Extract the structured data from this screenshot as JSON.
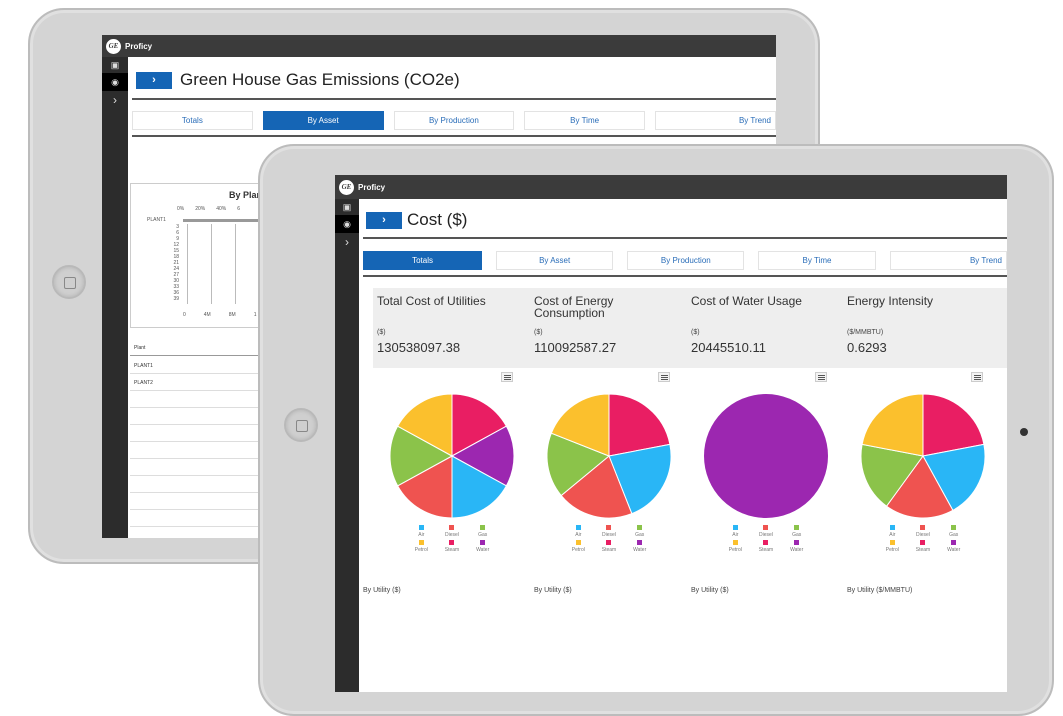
{
  "app_name": "Proficy",
  "colors": {
    "accent": "#1565b5",
    "topbar": "#3b3b3b",
    "sidebar": "#2c2c2c"
  },
  "back_tablet": {
    "page_title": "Green House Gas Emissions (CO2e)",
    "tabs": [
      {
        "label": "Totals",
        "active": false
      },
      {
        "label": "By Asset",
        "active": true
      },
      {
        "label": "By Production",
        "active": false
      },
      {
        "label": "By Time",
        "active": false
      },
      {
        "label": "By Trend",
        "active": false
      }
    ],
    "chart_title_partial": "By Plan",
    "top_axis_ticks": [
      "0%",
      "20%",
      "40%",
      "6"
    ],
    "row_label": "PLANT1",
    "y_ticks": [
      "3",
      "6",
      "9",
      "12",
      "15",
      "18",
      "21",
      "24",
      "27",
      "30",
      "33",
      "36",
      "39"
    ],
    "bottom_axis_ticks": [
      "0",
      "4M",
      "8M",
      "1"
    ],
    "table_header": "Plant",
    "table_rows": [
      "PLANT1",
      "PLANT2"
    ]
  },
  "front_tablet": {
    "page_title": "Cost ($)",
    "tabs": [
      {
        "label": "Totals",
        "active": true
      },
      {
        "label": "By Asset",
        "active": false
      },
      {
        "label": "By Production",
        "active": false
      },
      {
        "label": "By Time",
        "active": false
      },
      {
        "label": "By Trend",
        "active": false
      }
    ],
    "metrics": [
      {
        "label": "Total Cost of Utilities",
        "unit": "($)",
        "value": "130538097.38"
      },
      {
        "label": "Cost of Energy Consumption",
        "unit": "($)",
        "value": "110092587.27"
      },
      {
        "label": "Cost of Water Usage",
        "unit": "($)",
        "value": "20445510.11"
      },
      {
        "label": "Energy Intensity",
        "unit": "($/MMBTU)",
        "value": "0.6293"
      }
    ],
    "legend": [
      {
        "name": "Air",
        "color": "#29b6f6"
      },
      {
        "name": "Diesel",
        "color": "#ef5350"
      },
      {
        "name": "Gas",
        "color": "#8bc34a"
      },
      {
        "name": "Petrol",
        "color": "#fbc02d"
      },
      {
        "name": "Steam",
        "color": "#e91e63"
      },
      {
        "name": "Water",
        "color": "#9c27b0"
      }
    ],
    "captions": [
      "By Utility ($)",
      "By Utility ($)",
      "By Utility ($)",
      "By Utility ($/MMBTU)"
    ]
  },
  "chart_data": [
    {
      "type": "pie",
      "title": "",
      "labels": [
        "Steam",
        "Water",
        "Air",
        "Diesel",
        "Gas",
        "Petrol"
      ],
      "values": [
        17,
        16,
        17,
        17,
        16,
        17
      ]
    },
    {
      "type": "pie",
      "title": "",
      "labels": [
        "Steam",
        "Air",
        "Diesel",
        "Gas",
        "Petrol"
      ],
      "values": [
        22,
        22,
        20,
        17,
        19
      ]
    },
    {
      "type": "pie",
      "title": "",
      "labels": [
        "Water"
      ],
      "values": [
        100
      ]
    },
    {
      "type": "pie",
      "title": "",
      "labels": [
        "Steam",
        "Air",
        "Diesel",
        "Gas",
        "Petrol"
      ],
      "values": [
        22,
        20,
        18,
        18,
        22
      ]
    }
  ]
}
